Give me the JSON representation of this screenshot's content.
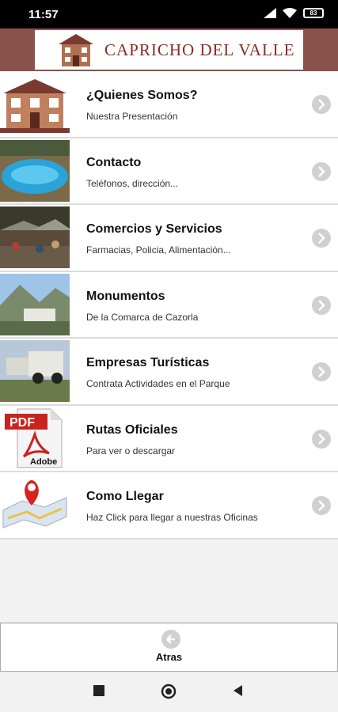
{
  "status_bar": {
    "time": "11:57",
    "battery": "83"
  },
  "header": {
    "brand": "CAPRICHO DEL VALLE",
    "brand_color": "#8b2a20",
    "bar_color": "#8b524c"
  },
  "menu": [
    {
      "title": "¿Quienes Somos?",
      "subtitle": "Nuestra Presentación",
      "icon": "house-image"
    },
    {
      "title": "Contacto",
      "subtitle": "Teléfonos, dirección...",
      "icon": "pool-image"
    },
    {
      "title": "Comercios y Servicios",
      "subtitle": "Farmacias, Policia, Alimentación...",
      "icon": "street-image"
    },
    {
      "title": "Monumentos",
      "subtitle": "De la Comarca de Cazorla",
      "icon": "mountain-village-image"
    },
    {
      "title": "Empresas Turísticas",
      "subtitle": "Contrata Actividades en el Parque",
      "icon": "jeep-image"
    },
    {
      "title": "Rutas Oficiales",
      "subtitle": "Para ver o descargar",
      "icon": "pdf-icon"
    },
    {
      "title": "Como Llegar",
      "subtitle": "Haz Click para llegar a nuestras Oficinas",
      "icon": "map-pin-icon"
    }
  ],
  "pdf_icon_text": {
    "pdf": "PDF",
    "adobe": "Adobe"
  },
  "footer": {
    "back_label": "Atras"
  }
}
